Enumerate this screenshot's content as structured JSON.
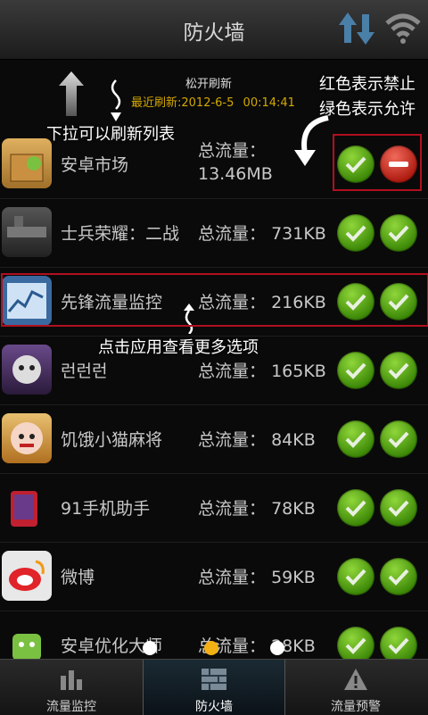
{
  "header": {
    "title": "防火墙",
    "sort_icon": "sort-arrows-icon",
    "wifi_icon": "wifi-icon"
  },
  "refresh": {
    "pull_text": "松开刷新",
    "last_refresh_label": "最近刷新:",
    "last_refresh_value": "2012-6-5",
    "last_refresh_time": "00:14:41"
  },
  "annotations": {
    "pull_hint": "下拉可以刷新列表",
    "legend_red": "红色表示禁止",
    "legend_green": "绿色表示允许",
    "click_hint": "点击应用查看更多选项"
  },
  "apps": [
    {
      "name": "安卓市场",
      "traffic_label": "总流量：",
      "traffic": "13.46MB",
      "wifi": "allowed",
      "mobile": "blocked"
    },
    {
      "name": "士兵荣耀：二战",
      "traffic_label": "总流量：",
      "traffic": "731KB",
      "wifi": "allowed",
      "mobile": "allowed"
    },
    {
      "name": "先锋流量监控",
      "traffic_label": "总流量：",
      "traffic": "216KB",
      "wifi": "allowed",
      "mobile": "allowed"
    },
    {
      "name": "런런런",
      "traffic_label": "总流量：",
      "traffic": "165KB",
      "wifi": "allowed",
      "mobile": "allowed"
    },
    {
      "name": "饥饿小猫麻将",
      "traffic_label": "总流量：",
      "traffic": "84KB",
      "wifi": "allowed",
      "mobile": "allowed"
    },
    {
      "name": "91手机助手",
      "traffic_label": "总流量：",
      "traffic": "78KB",
      "wifi": "allowed",
      "mobile": "allowed"
    },
    {
      "name": "微博",
      "traffic_label": "总流量：",
      "traffic": "59KB",
      "wifi": "allowed",
      "mobile": "allowed"
    },
    {
      "name": "安卓优化大师",
      "traffic_label": "总流量：",
      "traffic": "28KB",
      "wifi": "allowed",
      "mobile": "allowed"
    }
  ],
  "tabs": [
    {
      "label": "流量监控",
      "icon": "bar-chart-icon"
    },
    {
      "label": "防火墙",
      "icon": "firewall-icon",
      "active": true
    },
    {
      "label": "流量预警",
      "icon": "warning-icon"
    }
  ],
  "pager": {
    "pages": 3,
    "current": 2
  },
  "colors": {
    "allow": "#4a9a0c",
    "deny": "#c0281a",
    "accent": "#f2b015",
    "highlight_box": "#b01020"
  }
}
